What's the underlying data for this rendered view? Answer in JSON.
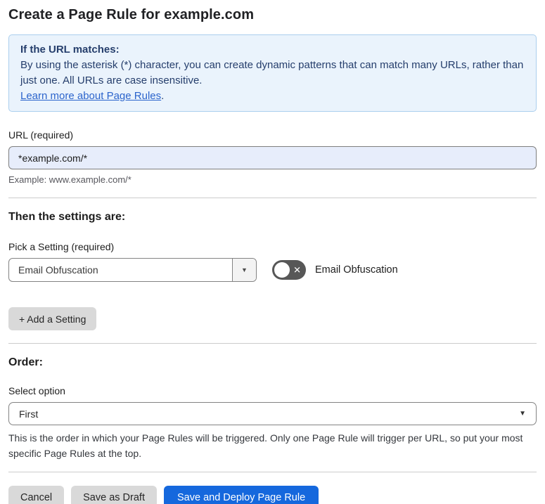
{
  "page": {
    "title": "Create a Page Rule for example.com"
  },
  "info_box": {
    "heading": "If the URL matches:",
    "body": "By using the asterisk (*) character, you can create dynamic patterns that can match many URLs, rather than just one. All URLs are case insensitive.",
    "link_label": "Learn more about Page Rules",
    "link_suffix": "."
  },
  "url_field": {
    "label": "URL (required)",
    "value": "*example.com/*",
    "example": "Example: www.example.com/*"
  },
  "settings": {
    "heading": "Then the settings are:",
    "pick_label": "Pick a Setting (required)",
    "selected_setting": "Email Obfuscation",
    "dropdown_arrow": "▼",
    "toggle": {
      "state": "off",
      "glyph": "✕",
      "label": "Email Obfuscation"
    },
    "add_button_label": "+ Add a Setting"
  },
  "order": {
    "heading": "Order:",
    "label": "Select option",
    "selected_option": "First",
    "dropdown_arrow": "▼",
    "description": "This is the order in which your Page Rules will be triggered. Only one Page Rule will trigger per URL, so put your most specific Page Rules at the top."
  },
  "footer": {
    "cancel": "Cancel",
    "save_draft": "Save as Draft",
    "save_deploy": "Save and Deploy Page Rule"
  },
  "colors": {
    "accent_blue": "#1568dd",
    "info_bg": "#eaf3fc",
    "info_border": "#abcfee",
    "info_text": "#253e6c",
    "link_blue": "#2b64cc",
    "input_bg": "#e7edfb",
    "button_gray": "#d9d9d9",
    "toggle_bg": "#575757",
    "divider": "#cccccc"
  }
}
